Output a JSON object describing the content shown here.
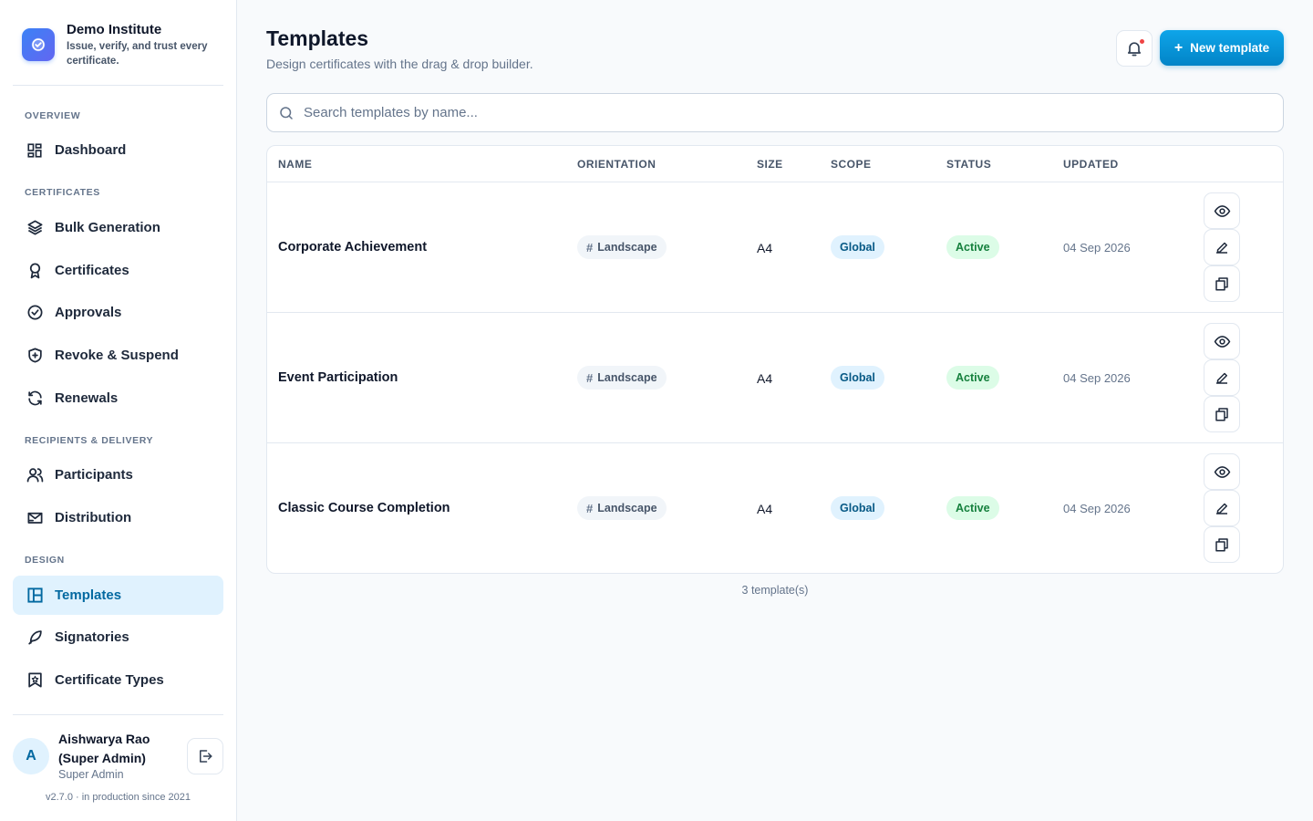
{
  "brand": {
    "name": "Demo Institute",
    "tagline": "Issue, verify, and trust every certificate."
  },
  "sidebar": {
    "sections": {
      "overview": "OVERVIEW",
      "certificates": "CERTIFICATES",
      "recipients": "RECIPIENTS & DELIVERY",
      "design": "DESIGN"
    },
    "items": [
      {
        "label": "Dashboard",
        "icon": "dashboard-icon"
      },
      {
        "label": "Bulk Generation",
        "icon": "layers-icon"
      },
      {
        "label": "Certificates",
        "icon": "award-icon"
      },
      {
        "label": "Approvals",
        "icon": "check-circle-icon"
      },
      {
        "label": "Revoke & Suspend",
        "icon": "shield-plus-icon"
      },
      {
        "label": "Renewals",
        "icon": "refresh-icon"
      },
      {
        "label": "Participants",
        "icon": "users-icon"
      },
      {
        "label": "Distribution",
        "icon": "mail-send-icon"
      },
      {
        "label": "Templates",
        "icon": "layout-icon",
        "active": true
      },
      {
        "label": "Signatories",
        "icon": "feather-icon"
      },
      {
        "label": "Certificate Types",
        "icon": "bookmark-star-icon"
      }
    ]
  },
  "user": {
    "initial": "A",
    "name": "Aishwarya Rao (Super Admin)",
    "role": "Super Admin",
    "version": "v2.7.0 · in production since 2021"
  },
  "header": {
    "title": "Templates",
    "subtitle": "Design certificates with the drag & drop builder.",
    "new_button": "New template",
    "has_notification": true
  },
  "search": {
    "placeholder": "Search templates by name..."
  },
  "table": {
    "columns": [
      "NAME",
      "ORIENTATION",
      "SIZE",
      "SCOPE",
      "STATUS",
      "UPDATED"
    ],
    "rows": [
      {
        "name": "Corporate Achievement",
        "orientation": "Landscape",
        "size": "A4",
        "scope": "Global",
        "status": "Active",
        "updated": "04 Sep 2026"
      },
      {
        "name": "Event Participation",
        "orientation": "Landscape",
        "size": "A4",
        "scope": "Global",
        "status": "Active",
        "updated": "04 Sep 2026"
      },
      {
        "name": "Classic Course Completion",
        "orientation": "Landscape",
        "size": "A4",
        "scope": "Global",
        "status": "Active",
        "updated": "04 Sep 2026"
      }
    ],
    "count_label": "3 template(s)"
  },
  "colors": {
    "accent": "#0284c7",
    "active_nav_bg": "#e0f2fe",
    "status_active_bg": "#dcfce7",
    "status_active_text": "#15803d",
    "scope_bg": "#e0f2fe",
    "notification_dot": "#ef4444"
  }
}
